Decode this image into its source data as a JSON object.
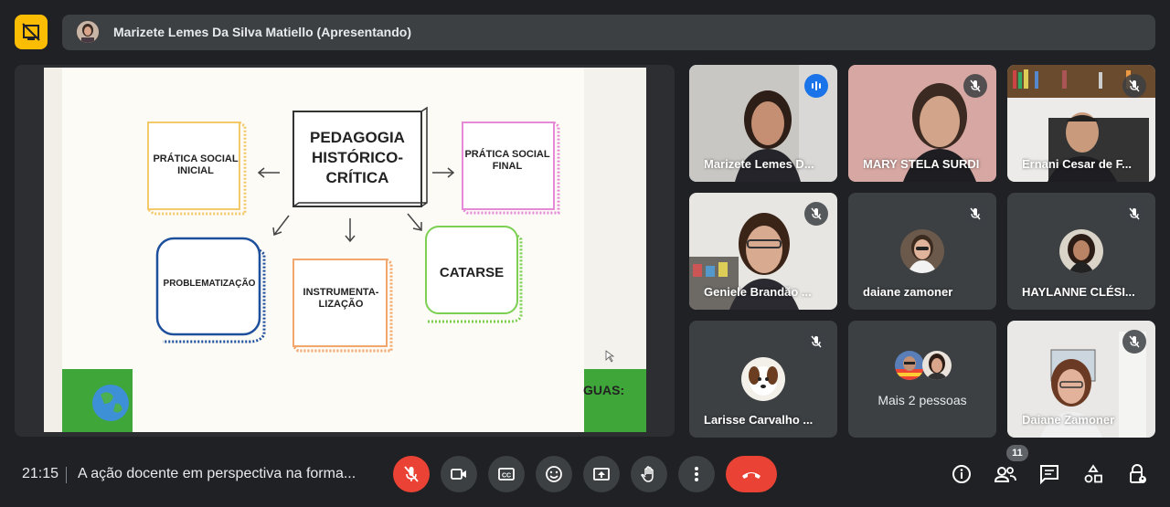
{
  "presenter_bar": {
    "text": "Marizete Lemes Da Silva Matiello (Apresentando)"
  },
  "slide": {
    "title": "PEDAGOGIA HISTÓRICO-CRÍTICA",
    "title_lines": [
      "PEDAGOGIA",
      "HISTÓRICO-",
      "CRÍTICA"
    ],
    "boxes": {
      "pratica_inicial": [
        "PRÁTICA SOCIAL",
        "INICIAL"
      ],
      "pratica_final": [
        "PRÁTICA SOCIAL",
        "FINAL"
      ],
      "problematizacao": "PROBLEMATIZAÇÃO",
      "instrumentalizacao": [
        "INSTRUMENTA-",
        "LIZAÇÃO"
      ],
      "catarse": "CATARSE"
    },
    "footer_fragment": "GUAS:",
    "colors": {
      "pratica_inicial": "#f3c969",
      "pratica_final": "#e58ad6",
      "problematizacao": "#1e4f9c",
      "instrumentalizacao": "#f2a66b",
      "catarse": "#7ccf52",
      "footer_green": "#3fa63a"
    }
  },
  "participants": [
    {
      "name": "Marizete Lemes D...",
      "speaking": true
    },
    {
      "name": "MARY STELA SURDI",
      "muted": true
    },
    {
      "name": "Ernani Cesar de F...",
      "muted": true
    },
    {
      "name": "Geniele Brandão ...",
      "muted": true
    },
    {
      "name": "daiane zamoner",
      "muted": true
    },
    {
      "name": "HAYLANNE CLÉSI...",
      "muted": true
    },
    {
      "name": "Larisse Carvalho ...",
      "muted": true
    },
    {
      "name": "Mais 2 pessoas"
    },
    {
      "name": "Daiane Zamoner",
      "muted": true
    }
  ],
  "bottom_bar": {
    "time": "21:15",
    "meeting_title": "A ação docente em perspectiva na forma...",
    "people_count": "11",
    "colors": {
      "danger": "#ea4335",
      "button": "#3c4043",
      "accent": "#fbbc04",
      "speaking": "#8ab4f8"
    }
  },
  "icons": {
    "present": "present-stop-icon",
    "mic_off": "mic-off-icon",
    "camera": "videocam-icon",
    "captions": "closed-caption-icon",
    "emoji": "emoji-icon",
    "present_screen": "present-screen-icon",
    "raise_hand": "raise-hand-icon",
    "more": "more-vert-icon",
    "hangup": "call-end-icon",
    "info": "info-icon",
    "people": "people-icon",
    "chat": "chat-icon",
    "activities": "activities-icon",
    "host_controls": "lock-person-icon"
  }
}
